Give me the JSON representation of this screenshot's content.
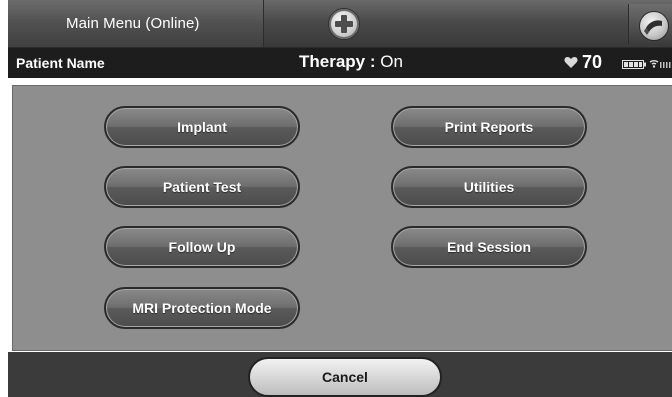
{
  "header": {
    "menu_title": "Main Menu (Online)",
    "add_icon": "plus-circle-icon",
    "device_icon": "programmer-wand-icon"
  },
  "status": {
    "patient_label": "Patient Name",
    "therapy_label": "Therapy :",
    "therapy_value": "On",
    "heart_icon": "heart-icon",
    "heart_rate": "70",
    "battery_icon": "battery-icon",
    "signal_icon": "signal-strength-icon"
  },
  "menu": {
    "implant": "Implant",
    "patient_test": "Patient Test",
    "follow_up": "Follow Up",
    "mri_protection_mode": "MRI Protection Mode",
    "print_reports": "Print Reports",
    "utilities": "Utilities",
    "end_session": "End Session"
  },
  "footer": {
    "cancel": "Cancel"
  },
  "colors": {
    "title_bar": "#4a4a4a",
    "status_bar": "#1d1d1d",
    "panel": "#8e8e8e",
    "button": "#5e5e5e",
    "cancel_button": "#d8d8d8"
  }
}
